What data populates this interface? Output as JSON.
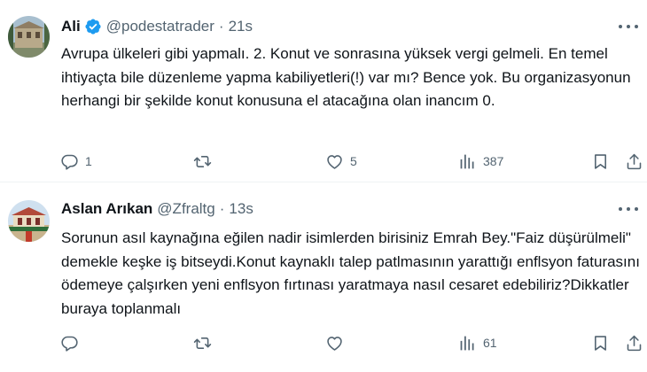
{
  "tweets": [
    {
      "name": "Ali",
      "verified": true,
      "handle": "@podestatrader",
      "separator": "·",
      "time": "21s",
      "text": "Avrupa ülkeleri gibi yapmalı. 2. Konut ve sonrasına yüksek vergi gelmeli. En temel ihtiyaçta bile düzenleme yapma kabiliyetleri(!) var mı? Bence yok. Bu organizasyonun herhangi bir şekilde konut konusuna el atacağına olan inancım 0.",
      "reply_count": "1",
      "retweet_count": "",
      "like_count": "5",
      "view_count": "387"
    },
    {
      "name": "Aslan Arıkan",
      "verified": false,
      "handle": "@Zfraltg",
      "separator": "·",
      "time": "13s",
      "text": "Sorunun asıl kaynağına eğilen nadir isimlerden birisiniz Emrah Bey.\"Faiz düşürülmeli\" demekle keşke iş bitseydi.Konut kaynaklı talep patlmasının yarattığı enflsyon faturasını ödemeye çalşırken yeni enflsyon fırtınası yaratmaya nasıl cesaret edebiliriz?Dikkatler buraya toplanmalı",
      "reply_count": "",
      "retweet_count": "",
      "like_count": "",
      "view_count": "61"
    }
  ],
  "colors": {
    "text": "#0f1419",
    "secondary": "#536471",
    "verified": "#1d9bf0",
    "divider": "#eff3f4"
  },
  "icons": [
    "reply-icon",
    "retweet-icon",
    "like-icon",
    "views-icon",
    "bookmark-icon",
    "share-icon",
    "more-icon",
    "verified-badge-icon"
  ]
}
